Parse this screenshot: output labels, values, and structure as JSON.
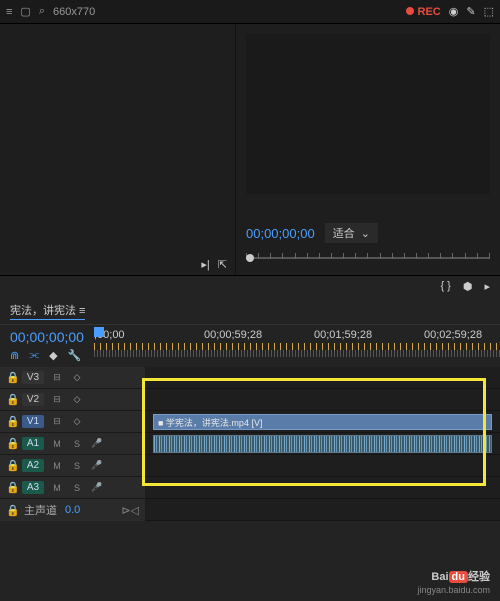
{
  "topbar": {
    "search_text": "660x770",
    "rec_label": "REC"
  },
  "preview": {
    "timecode": "00;00;00;00",
    "fit_label": "适合"
  },
  "sequence": {
    "title": "宪法，讲宪法 ≡"
  },
  "timeline": {
    "timecode": "00;00;00;00",
    "ruler": [
      ";00;00",
      "00;00;59;28",
      "00;01;59;28",
      "00;02;59;28"
    ]
  },
  "tracks": {
    "v3": {
      "label": "V3",
      "b1": "⊟",
      "b2": "◇"
    },
    "v2": {
      "label": "V2",
      "b1": "⊟",
      "b2": "◇"
    },
    "v1": {
      "label": "V1",
      "b1": "⊟",
      "b2": "◇"
    },
    "a1": {
      "label": "A1",
      "b1": "M",
      "b2": "S"
    },
    "a2": {
      "label": "A2",
      "b1": "M",
      "b2": "S"
    },
    "a3": {
      "label": "A3",
      "b1": "M",
      "b2": "S"
    },
    "clip_name": "■ 学宪法，讲宪法.mp4 [V]"
  },
  "master": {
    "label": "主声道",
    "value": "0.0",
    "control": "⊳◁"
  },
  "watermark": {
    "brand_pre": "Bai",
    "brand_du": "du",
    "brand_post": "经验",
    "url": "jingyan.baidu.com"
  }
}
